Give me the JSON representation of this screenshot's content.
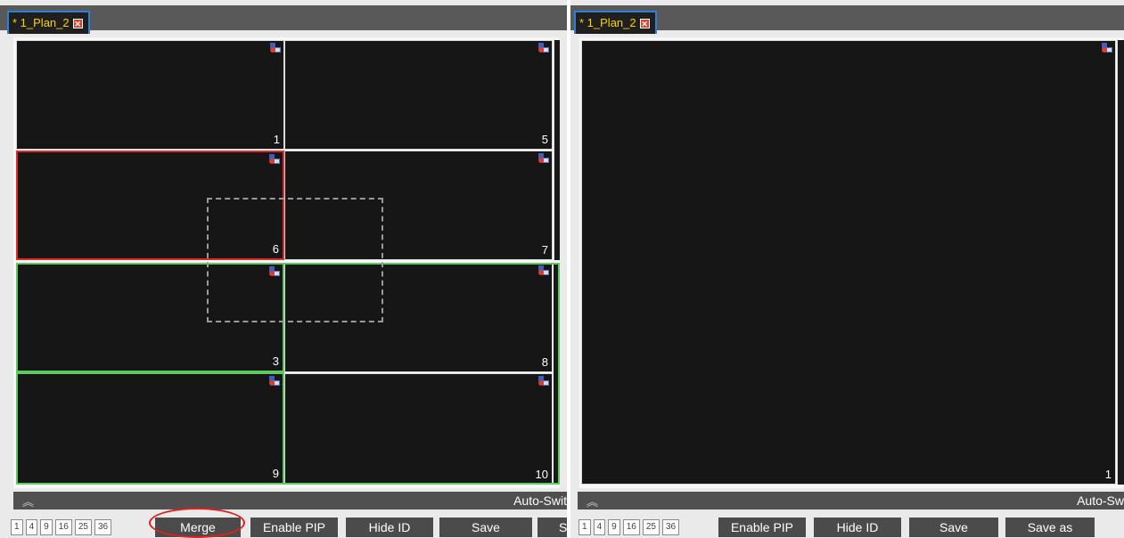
{
  "left": {
    "tab": {
      "title": "* 1_Plan_2",
      "close_icon": "close-icon"
    },
    "cells": [
      {
        "id": "1"
      },
      {
        "id": "5"
      },
      {
        "id": "6"
      },
      {
        "id": "7"
      },
      {
        "id": "3"
      },
      {
        "id": "8"
      },
      {
        "id": "9"
      },
      {
        "id": "10"
      }
    ],
    "autobar": {
      "label": "Auto-Swit"
    },
    "layout_buttons": [
      "1",
      "4",
      "9",
      "16",
      "25",
      "36"
    ],
    "actions": {
      "merge": "Merge",
      "enable_pip": "Enable PIP",
      "hide_id": "Hide ID",
      "save": "Save",
      "save_as": "S"
    }
  },
  "right": {
    "tab": {
      "title": "* 1_Plan_2",
      "close_icon": "close-icon"
    },
    "cells": [
      {
        "id": "1"
      }
    ],
    "autobar": {
      "label": "Auto-Sw"
    },
    "layout_buttons": [
      "1",
      "4",
      "9",
      "16",
      "25",
      "36"
    ],
    "actions": {
      "enable_pip": "Enable PIP",
      "hide_id": "Hide ID",
      "save": "Save",
      "save_as": "Save as"
    }
  },
  "colors": {
    "selected": "#e02a2a",
    "group": "#5ec95e",
    "tab_text": "#ffd200",
    "tab_border": "#2f7fd6"
  }
}
